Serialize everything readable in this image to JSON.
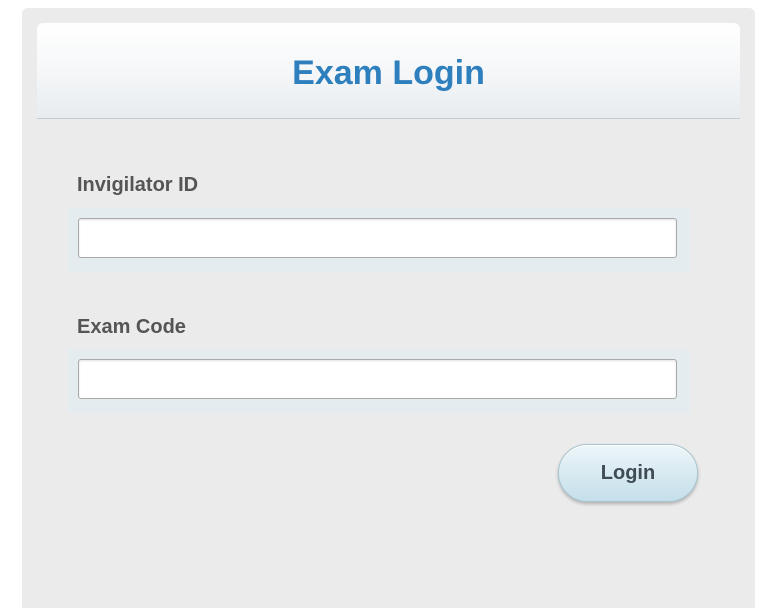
{
  "form": {
    "title": "Exam Login",
    "fields": [
      {
        "label": "Invigilator ID",
        "value": "",
        "placeholder": ""
      },
      {
        "label": "Exam Code",
        "value": "",
        "placeholder": ""
      }
    ],
    "submit_label": "Login"
  }
}
